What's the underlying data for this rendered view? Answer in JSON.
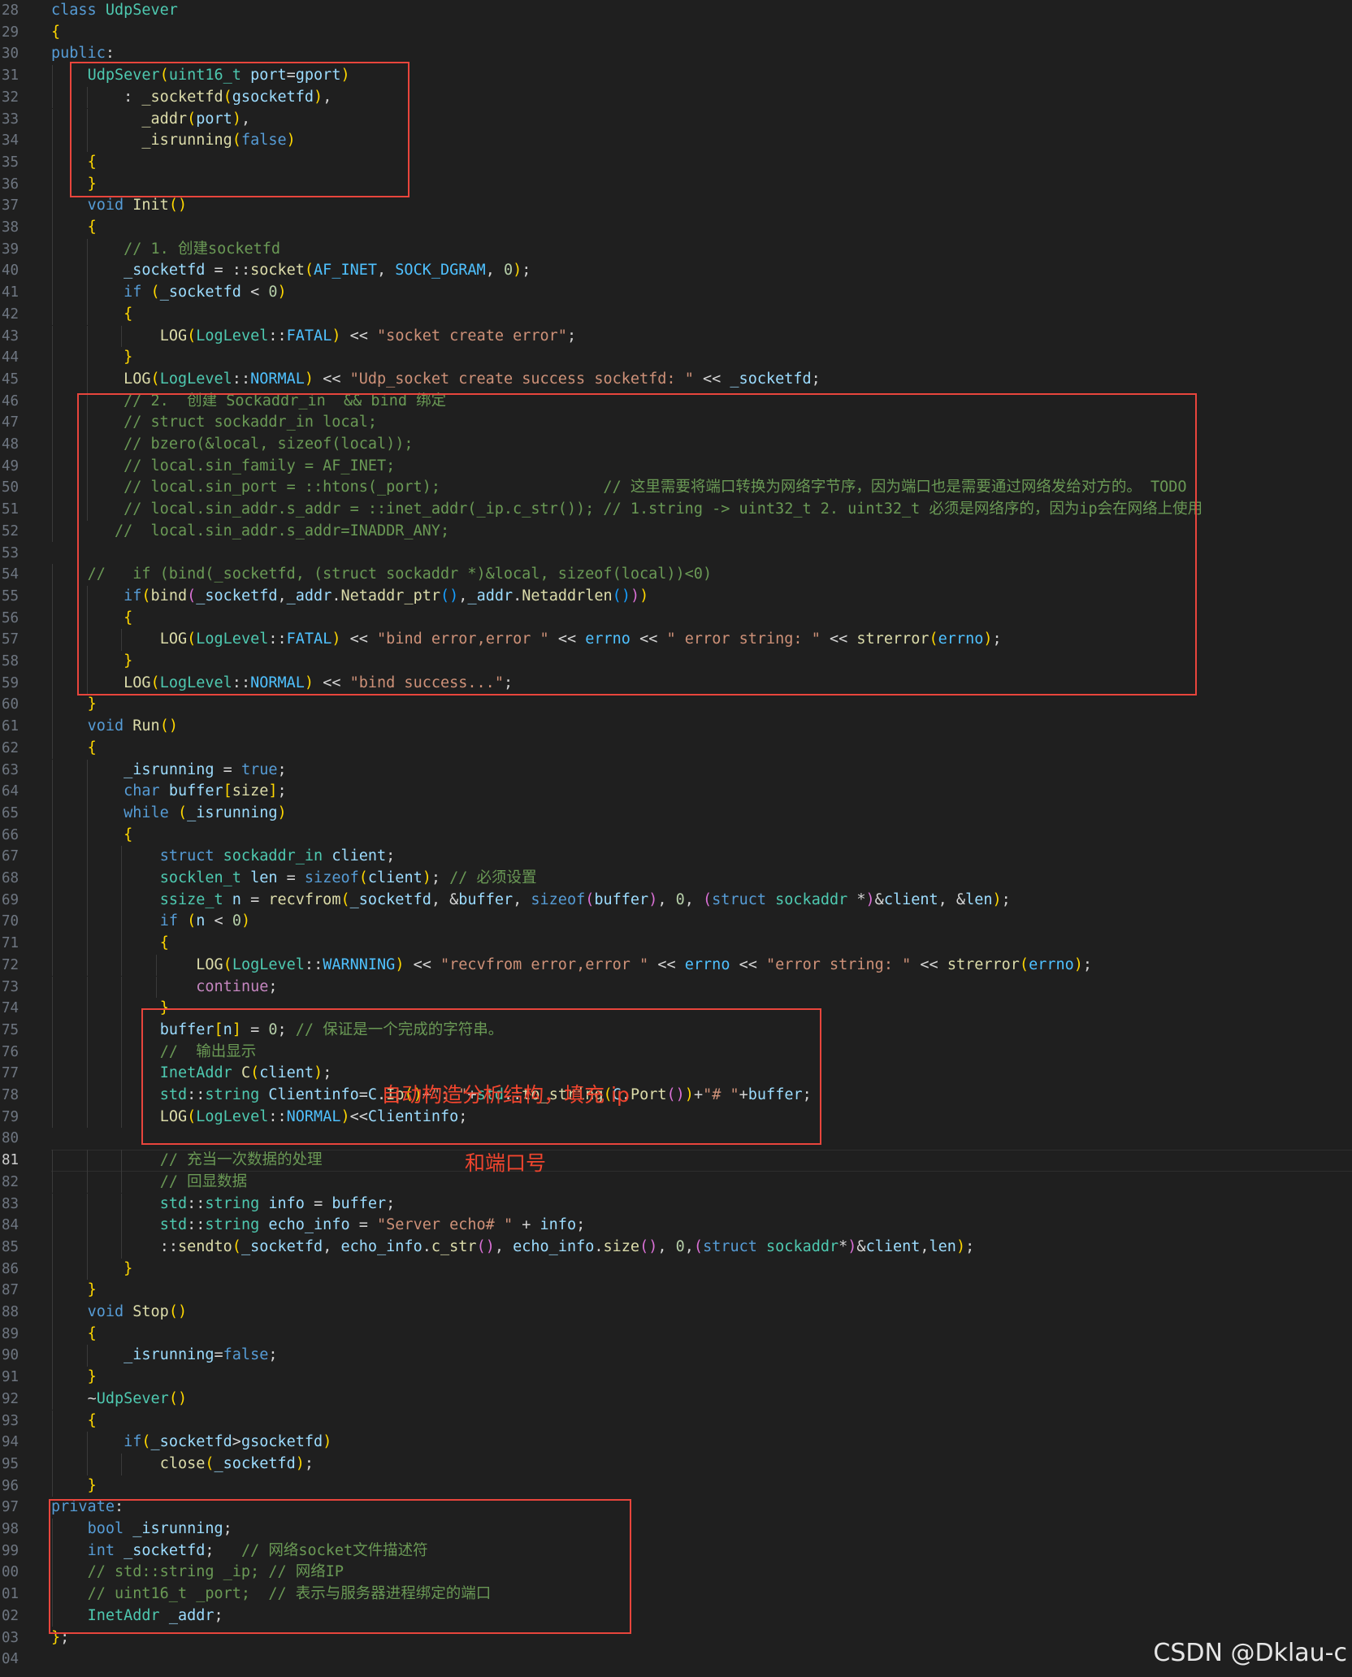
{
  "annotation": {
    "line1": "自动构造分析结构，填充 ip",
    "line2": "和端口号"
  },
  "watermark": "CSDN @Dklau-c",
  "colors": {
    "background": "#1f1f1f",
    "keyword": "#569cd6",
    "comment": "#6a9955",
    "string": "#ce9178",
    "function": "#dcdcaa",
    "type": "#4ec9b0",
    "variable": "#9cdcfe",
    "highlight_box": "#e8453c"
  },
  "editor": {
    "active_line": "81",
    "lines": [
      {
        "no": "28",
        "text": "class UdpSever"
      },
      {
        "no": "29",
        "text": "{"
      },
      {
        "no": "30",
        "text": "public:"
      },
      {
        "no": "31",
        "text": "    UdpSever(uint16_t port=gport)"
      },
      {
        "no": "32",
        "text": "        : _socketfd(gsocketfd),"
      },
      {
        "no": "33",
        "text": "          _addr(port),"
      },
      {
        "no": "34",
        "text": "          _isrunning(false)"
      },
      {
        "no": "35",
        "text": "    {"
      },
      {
        "no": "36",
        "text": "    }"
      },
      {
        "no": "37",
        "text": "    void Init()"
      },
      {
        "no": "38",
        "text": "    {"
      },
      {
        "no": "39",
        "text": "        // 1. 创建socketfd"
      },
      {
        "no": "40",
        "text": "        _socketfd = ::socket(AF_INET, SOCK_DGRAM, 0);"
      },
      {
        "no": "41",
        "text": "        if (_socketfd < 0)"
      },
      {
        "no": "42",
        "text": "        {"
      },
      {
        "no": "43",
        "text": "            LOG(LogLevel::FATAL) << \"socket create error\";"
      },
      {
        "no": "44",
        "text": "        }"
      },
      {
        "no": "45",
        "text": "        LOG(LogLevel::NORMAL) << \"Udp_socket create success socketfd: \" << _socketfd;"
      },
      {
        "no": "46",
        "text": "        // 2.  创建 Sockaddr_in  && bind 绑定"
      },
      {
        "no": "47",
        "text": "        // struct sockaddr_in local;"
      },
      {
        "no": "48",
        "text": "        // bzero(&local, sizeof(local));"
      },
      {
        "no": "49",
        "text": "        // local.sin_family = AF_INET;"
      },
      {
        "no": "50",
        "text": "        // local.sin_port = ::htons(_port);                  // 这里需要将端口转换为网络字节序，因为端口也是需要通过网络发给对方的。 TODO"
      },
      {
        "no": "51",
        "text": "        // local.sin_addr.s_addr = ::inet_addr(_ip.c_str()); // 1.string -> uint32_t 2. uint32_t 必须是网络序的，因为ip会在网络上使用"
      },
      {
        "no": "52",
        "text": "       //  local.sin_addr.s_addr=INADDR_ANY;"
      },
      {
        "no": "53",
        "text": ""
      },
      {
        "no": "54",
        "text": "    //   if (bind(_socketfd, (struct sockaddr *)&local, sizeof(local))<0)"
      },
      {
        "no": "55",
        "text": "        if(bind(_socketfd,_addr.Netaddr_ptr(),_addr.Netaddrlen()))"
      },
      {
        "no": "56",
        "text": "        {"
      },
      {
        "no": "57",
        "text": "            LOG(LogLevel::FATAL) << \"bind error,error \" << errno << \" error string: \" << strerror(errno);"
      },
      {
        "no": "58",
        "text": "        }"
      },
      {
        "no": "59",
        "text": "        LOG(LogLevel::NORMAL) << \"bind success...\";"
      },
      {
        "no": "60",
        "text": "    }"
      },
      {
        "no": "61",
        "text": "    void Run()"
      },
      {
        "no": "62",
        "text": "    {"
      },
      {
        "no": "63",
        "text": "        _isrunning = true;"
      },
      {
        "no": "64",
        "text": "        char buffer[size];"
      },
      {
        "no": "65",
        "text": "        while (_isrunning)"
      },
      {
        "no": "66",
        "text": "        {"
      },
      {
        "no": "67",
        "text": "            struct sockaddr_in client;"
      },
      {
        "no": "68",
        "text": "            socklen_t len = sizeof(client); // 必须设置"
      },
      {
        "no": "69",
        "text": "            ssize_t n = recvfrom(_socketfd, &buffer, sizeof(buffer), 0, (struct sockaddr *)&client, &len);"
      },
      {
        "no": "70",
        "text": "            if (n < 0)"
      },
      {
        "no": "71",
        "text": "            {"
      },
      {
        "no": "72",
        "text": "                LOG(LogLevel::WARNNING) << \"recvfrom error,error \" << errno << \"error string: \" << strerror(errno);"
      },
      {
        "no": "73",
        "text": "                continue;"
      },
      {
        "no": "74",
        "text": "            }"
      },
      {
        "no": "75",
        "text": "            buffer[n] = 0; // 保证是一个完成的字符串。"
      },
      {
        "no": "76",
        "text": "            //  输出显示"
      },
      {
        "no": "77",
        "text": "            InetAddr C(client);"
      },
      {
        "no": "78",
        "text": "            std::string Clientinfo=C.Ip()+\": \"+std::to_string(C.Port())+\"# \"+buffer;"
      },
      {
        "no": "79",
        "text": "            LOG(LogLevel::NORMAL)<<Clientinfo;"
      },
      {
        "no": "80",
        "text": ""
      },
      {
        "no": "81",
        "text": "            // 充当一次数据的处理"
      },
      {
        "no": "82",
        "text": "            // 回显数据"
      },
      {
        "no": "83",
        "text": "            std::string info = buffer;"
      },
      {
        "no": "84",
        "text": "            std::string echo_info = \"Server echo# \" + info;"
      },
      {
        "no": "85",
        "text": "            ::sendto(_socketfd, echo_info.c_str(), echo_info.size(), 0,(struct sockaddr*)&client,len);"
      },
      {
        "no": "86",
        "text": "        }"
      },
      {
        "no": "87",
        "text": "    }"
      },
      {
        "no": "88",
        "text": "    void Stop()"
      },
      {
        "no": "89",
        "text": "    {"
      },
      {
        "no": "90",
        "text": "        _isrunning=false;"
      },
      {
        "no": "91",
        "text": "    }"
      },
      {
        "no": "92",
        "text": "    ~UdpSever()"
      },
      {
        "no": "93",
        "text": "    {"
      },
      {
        "no": "94",
        "text": "        if(_socketfd>gsocketfd)"
      },
      {
        "no": "95",
        "text": "            close(_socketfd);"
      },
      {
        "no": "96",
        "text": "    }"
      },
      {
        "no": "97",
        "text": "private:"
      },
      {
        "no": "98",
        "text": "    bool _isrunning;"
      },
      {
        "no": "99",
        "text": "    int _socketfd;   // 网络socket文件描述符"
      },
      {
        "no": "00",
        "text": "    // std::string _ip; // 网络IP"
      },
      {
        "no": "01",
        "text": "    // uint16_t _port;  // 表示与服务器进程绑定的端口"
      },
      {
        "no": "02",
        "text": "    InetAddr _addr;"
      },
      {
        "no": "03",
        "text": "};"
      },
      {
        "no": "04",
        "text": ""
      }
    ]
  }
}
